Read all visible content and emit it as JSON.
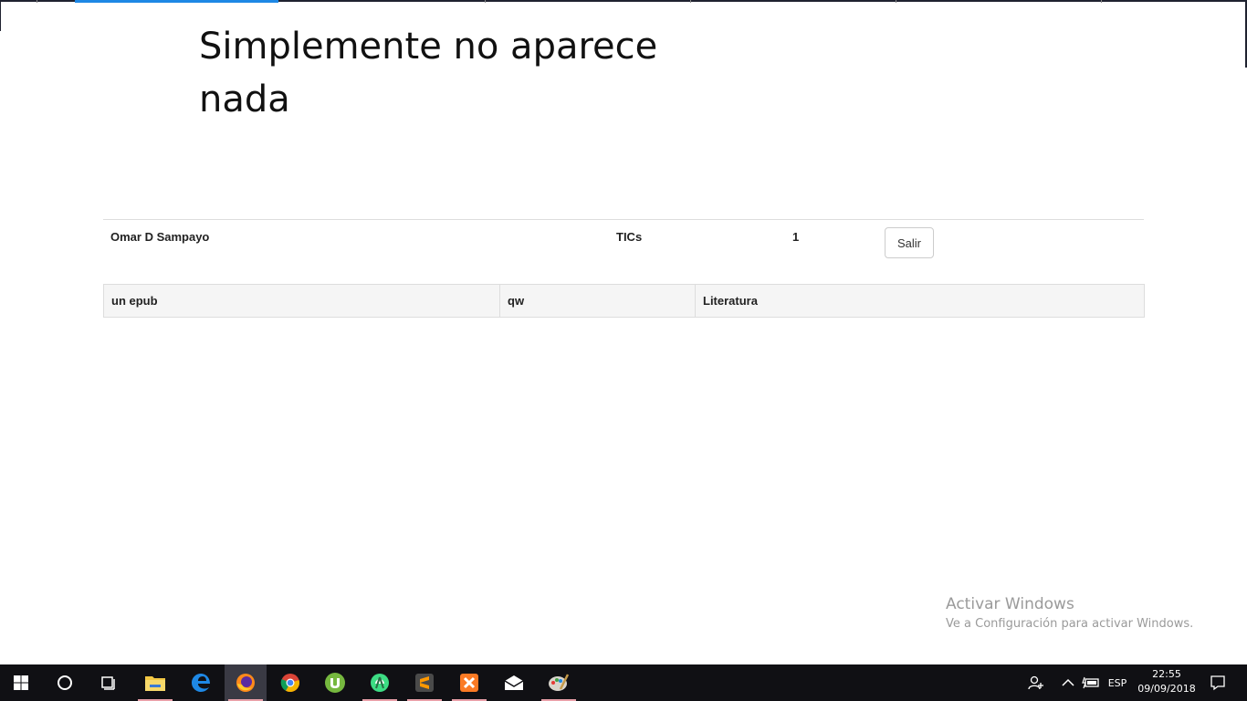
{
  "page": {
    "heading": "Simplemente no aparece nada"
  },
  "user_row": {
    "name": "Omar D Sampayo",
    "department": "TICs",
    "count": "1",
    "logout_label": "Salir"
  },
  "books": [
    {
      "title": "un epub",
      "author": "qw",
      "category": "Literatura"
    }
  ],
  "watermark": {
    "title": "Activar Windows",
    "subtitle": "Ve a Configuración para activar Windows."
  },
  "taskbar": {
    "apps": [
      {
        "name": "start-icon"
      },
      {
        "name": "cortana-icon"
      },
      {
        "name": "task-view-icon"
      },
      {
        "name": "file-explorer-icon"
      },
      {
        "name": "edge-icon"
      },
      {
        "name": "firefox-icon"
      },
      {
        "name": "chrome-icon"
      },
      {
        "name": "utorrent-icon"
      },
      {
        "name": "android-studio-icon"
      },
      {
        "name": "sublime-text-icon"
      },
      {
        "name": "xampp-icon"
      },
      {
        "name": "mail-icon"
      },
      {
        "name": "paint-icon"
      }
    ],
    "language": "ESP",
    "time": "22:55",
    "date": "09/09/2018"
  }
}
